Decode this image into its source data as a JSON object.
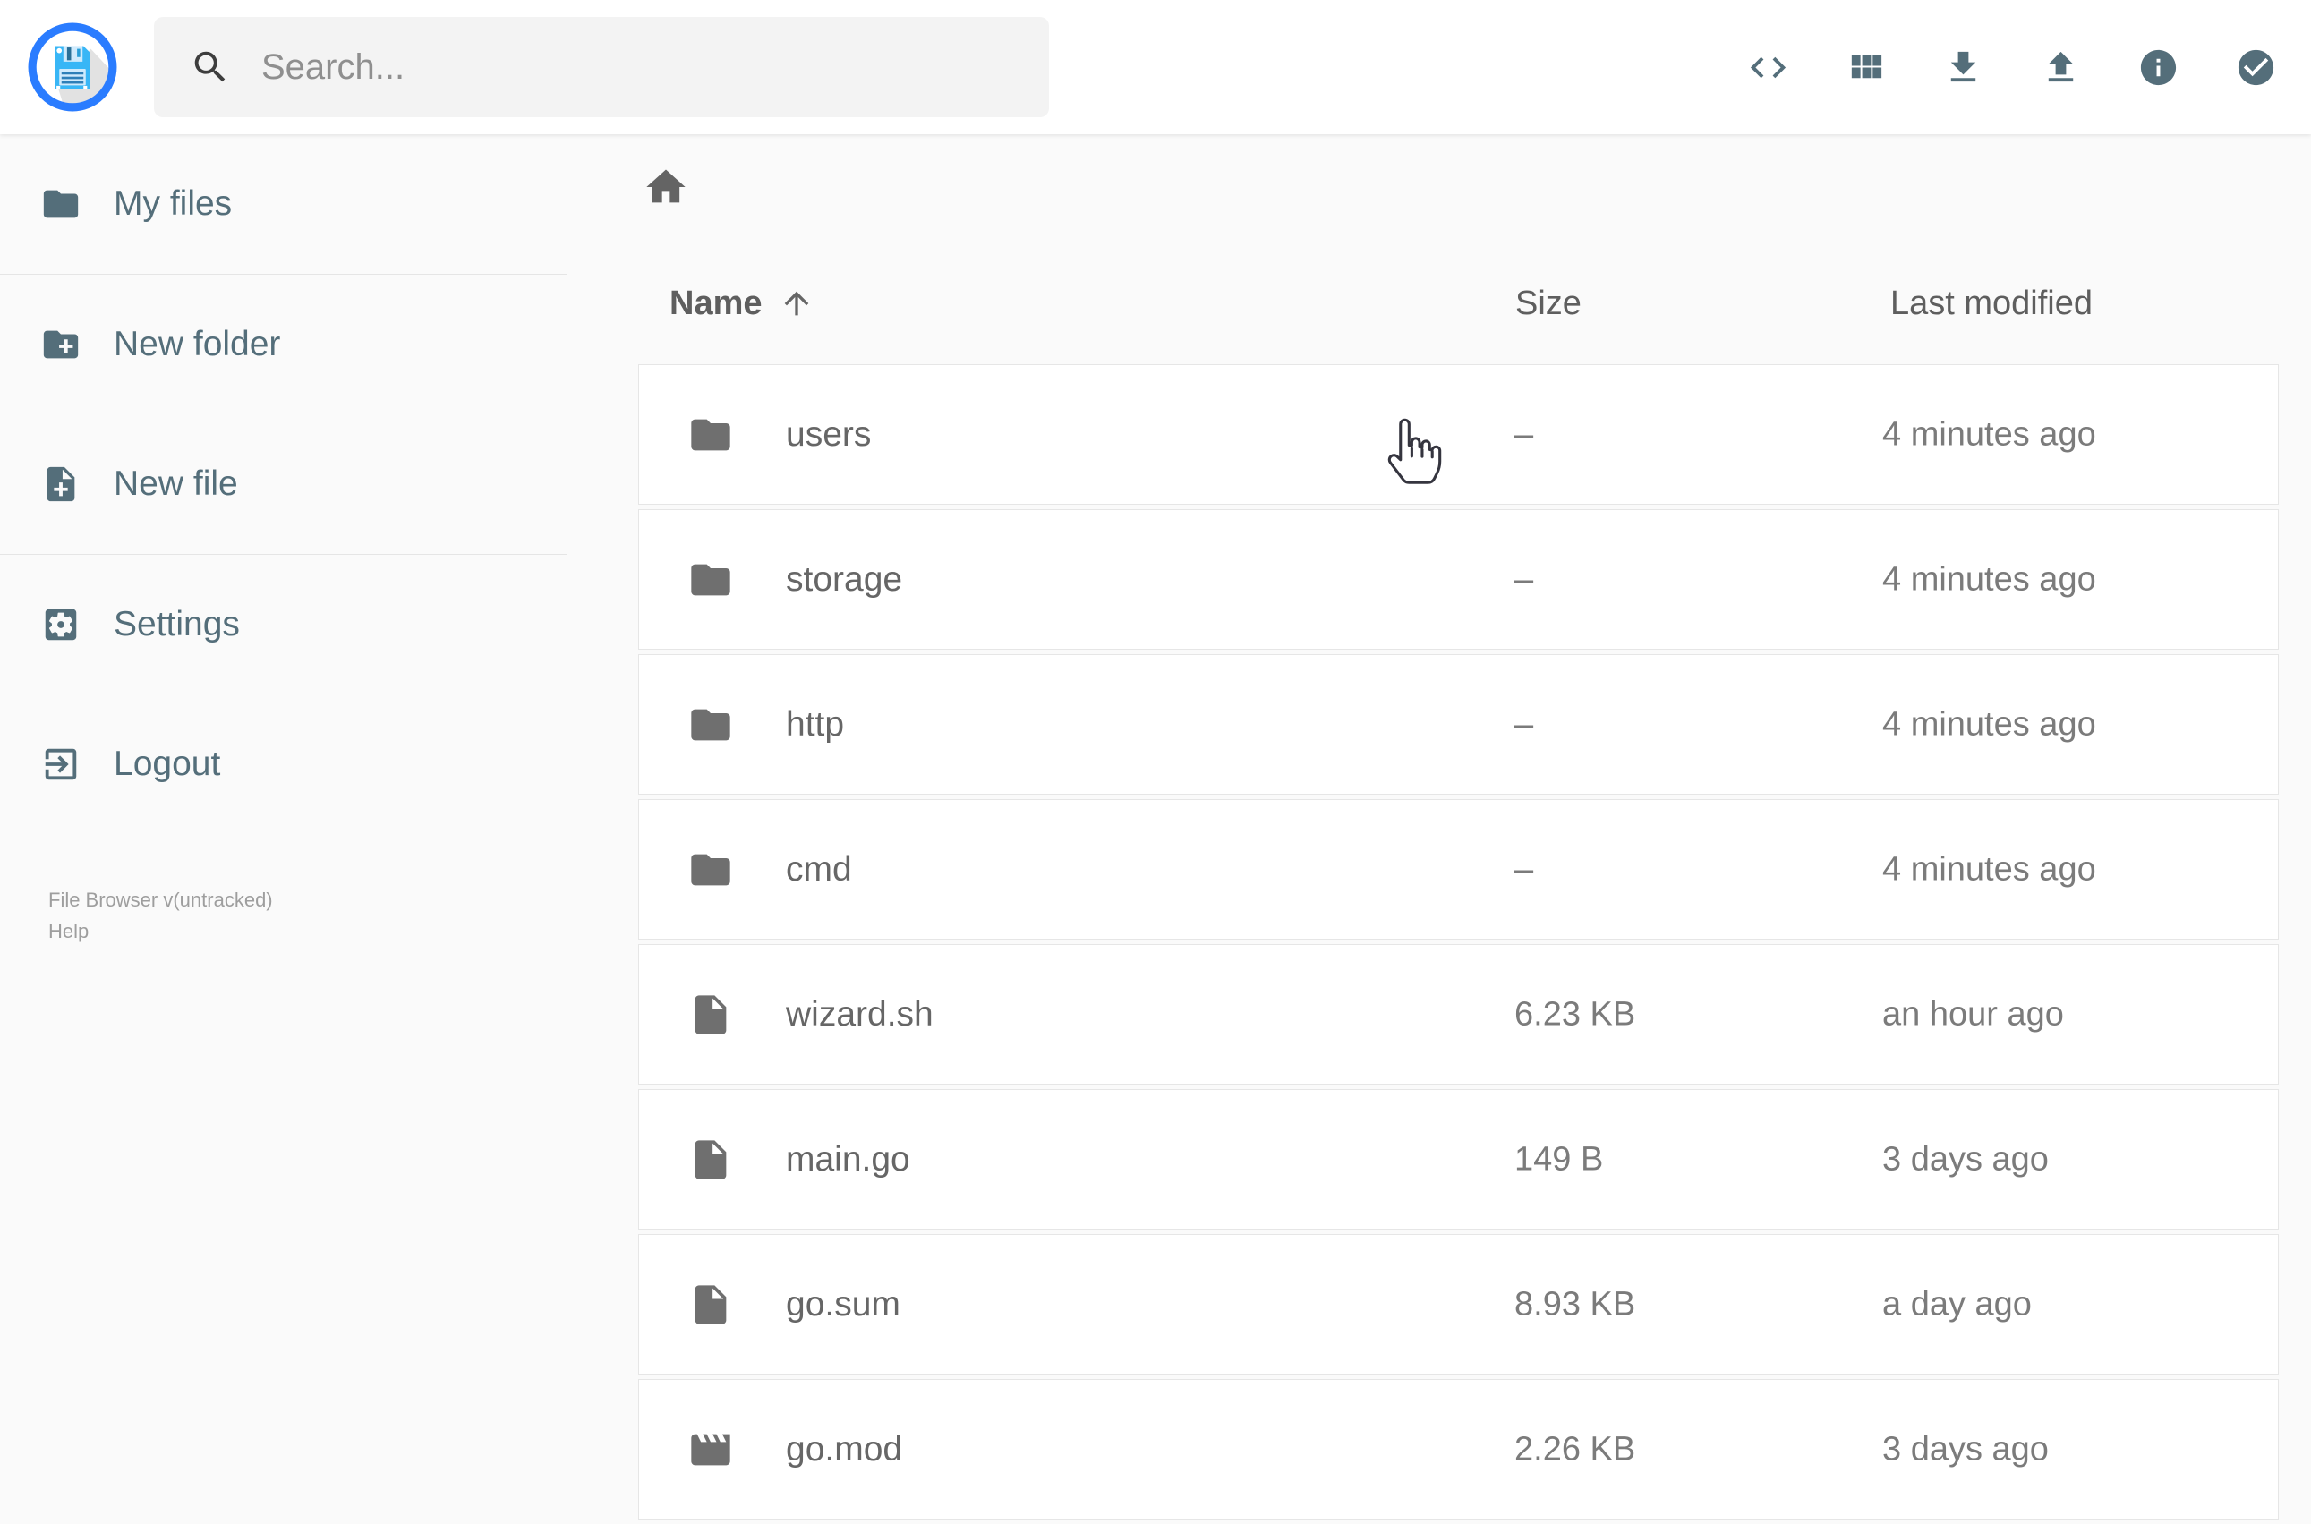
{
  "header": {
    "logo_icon": "floppy-disk",
    "search": {
      "placeholder": "Search...",
      "icon": "search"
    },
    "actions": [
      {
        "name": "shell",
        "icon": "code"
      },
      {
        "name": "view-mode",
        "icon": "grid"
      },
      {
        "name": "download",
        "icon": "download"
      },
      {
        "name": "upload",
        "icon": "upload"
      },
      {
        "name": "info",
        "icon": "info"
      },
      {
        "name": "select-multiple",
        "icon": "check-circle"
      }
    ]
  },
  "sidebar": {
    "items": [
      {
        "label": "My files",
        "icon": "folder"
      },
      {
        "label": "New folder",
        "icon": "folder-plus"
      },
      {
        "label": "New file",
        "icon": "file-plus"
      },
      {
        "label": "Settings",
        "icon": "settings"
      },
      {
        "label": "Logout",
        "icon": "logout"
      }
    ],
    "footer": {
      "version": "File Browser v(untracked)",
      "help": "Help"
    }
  },
  "breadcrumb": {
    "home_icon": "home"
  },
  "listing": {
    "columns": {
      "name": "Name",
      "size": "Size",
      "modified": "Last modified"
    },
    "sort": {
      "column": "name",
      "direction": "ascending",
      "icon": "arrow-up"
    },
    "rows": [
      {
        "name": "users",
        "icon": "folder",
        "size": "–",
        "modified": "4 minutes ago"
      },
      {
        "name": "storage",
        "icon": "folder",
        "size": "–",
        "modified": "4 minutes ago"
      },
      {
        "name": "http",
        "icon": "folder",
        "size": "–",
        "modified": "4 minutes ago"
      },
      {
        "name": "cmd",
        "icon": "folder",
        "size": "–",
        "modified": "4 minutes ago"
      },
      {
        "name": "wizard.sh",
        "icon": "file",
        "size": "6.23 KB",
        "modified": "an hour ago"
      },
      {
        "name": "main.go",
        "icon": "file",
        "size": "149 B",
        "modified": "3 days ago"
      },
      {
        "name": "go.sum",
        "icon": "file",
        "size": "8.93 KB",
        "modified": "a day ago"
      },
      {
        "name": "go.mod",
        "icon": "movie",
        "size": "2.26 KB",
        "modified": "3 days ago"
      }
    ]
  },
  "cursor": {
    "type": "hand-pointer"
  },
  "colors": {
    "accent_blue": "#2a7cff",
    "logo_disk_blue": "#38b6f6",
    "icon_slate": "#546e7a",
    "icon_gray": "#6f6f6f",
    "name_text": "#666666",
    "meta_text": "#7b7b7b",
    "page_bg": "#fafafa",
    "card_border": "#e6e6e6"
  }
}
